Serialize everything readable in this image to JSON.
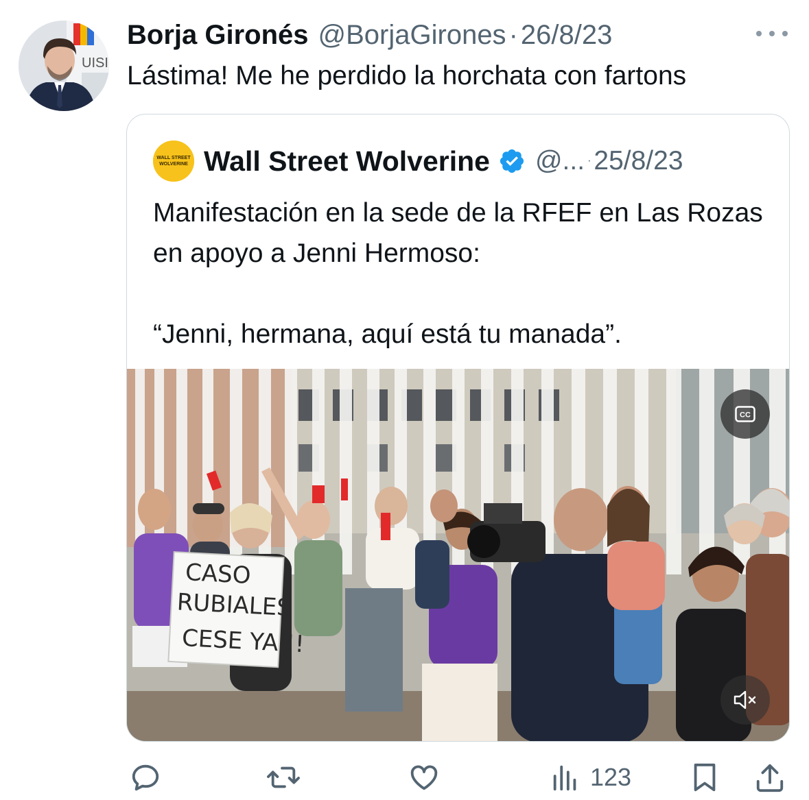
{
  "tweet": {
    "author_name": "Borja Gironés",
    "author_handle": "@BorjaGirones",
    "separator": "·",
    "date": "26/8/23",
    "text": "Lástima! Me he perdido la horchata con fartons"
  },
  "quoted_tweet": {
    "author_name": "Wall Street Wolverine",
    "author_handle": "@...",
    "separator": "·",
    "date": "25/8/23",
    "logo_text_line1": "WALL STREET",
    "logo_text_line2": "WOLVERINE",
    "text_line1": "Manifestación en la sede de la RFEF en Las Rozas en apoyo a Jenni Hermoso:",
    "text_line2": "“Jenni, hermana, aquí está tu manada”.",
    "video": {
      "sign_line1": "CASO",
      "sign_line2": "RUBIALES",
      "sign_line3": "CESE YA !!",
      "cc_label": "CC"
    }
  },
  "avatar_sign_text": "UISIT",
  "actions": {
    "views_count": "123"
  },
  "colors": {
    "text_primary": "#0f1419",
    "text_secondary": "#536471",
    "verified_blue": "#1d9bf0",
    "card_border": "#cfd9de",
    "wsw_logo_yellow": "#f7c21b"
  },
  "icons": {
    "more": "more-horizontal-icon",
    "verified": "verified-badge-icon",
    "cc": "closed-captions-icon",
    "mute": "volume-muted-icon",
    "reply": "reply-icon",
    "retweet": "retweet-icon",
    "like": "heart-icon",
    "views": "views-chart-icon",
    "bookmark": "bookmark-icon",
    "share": "share-icon"
  }
}
